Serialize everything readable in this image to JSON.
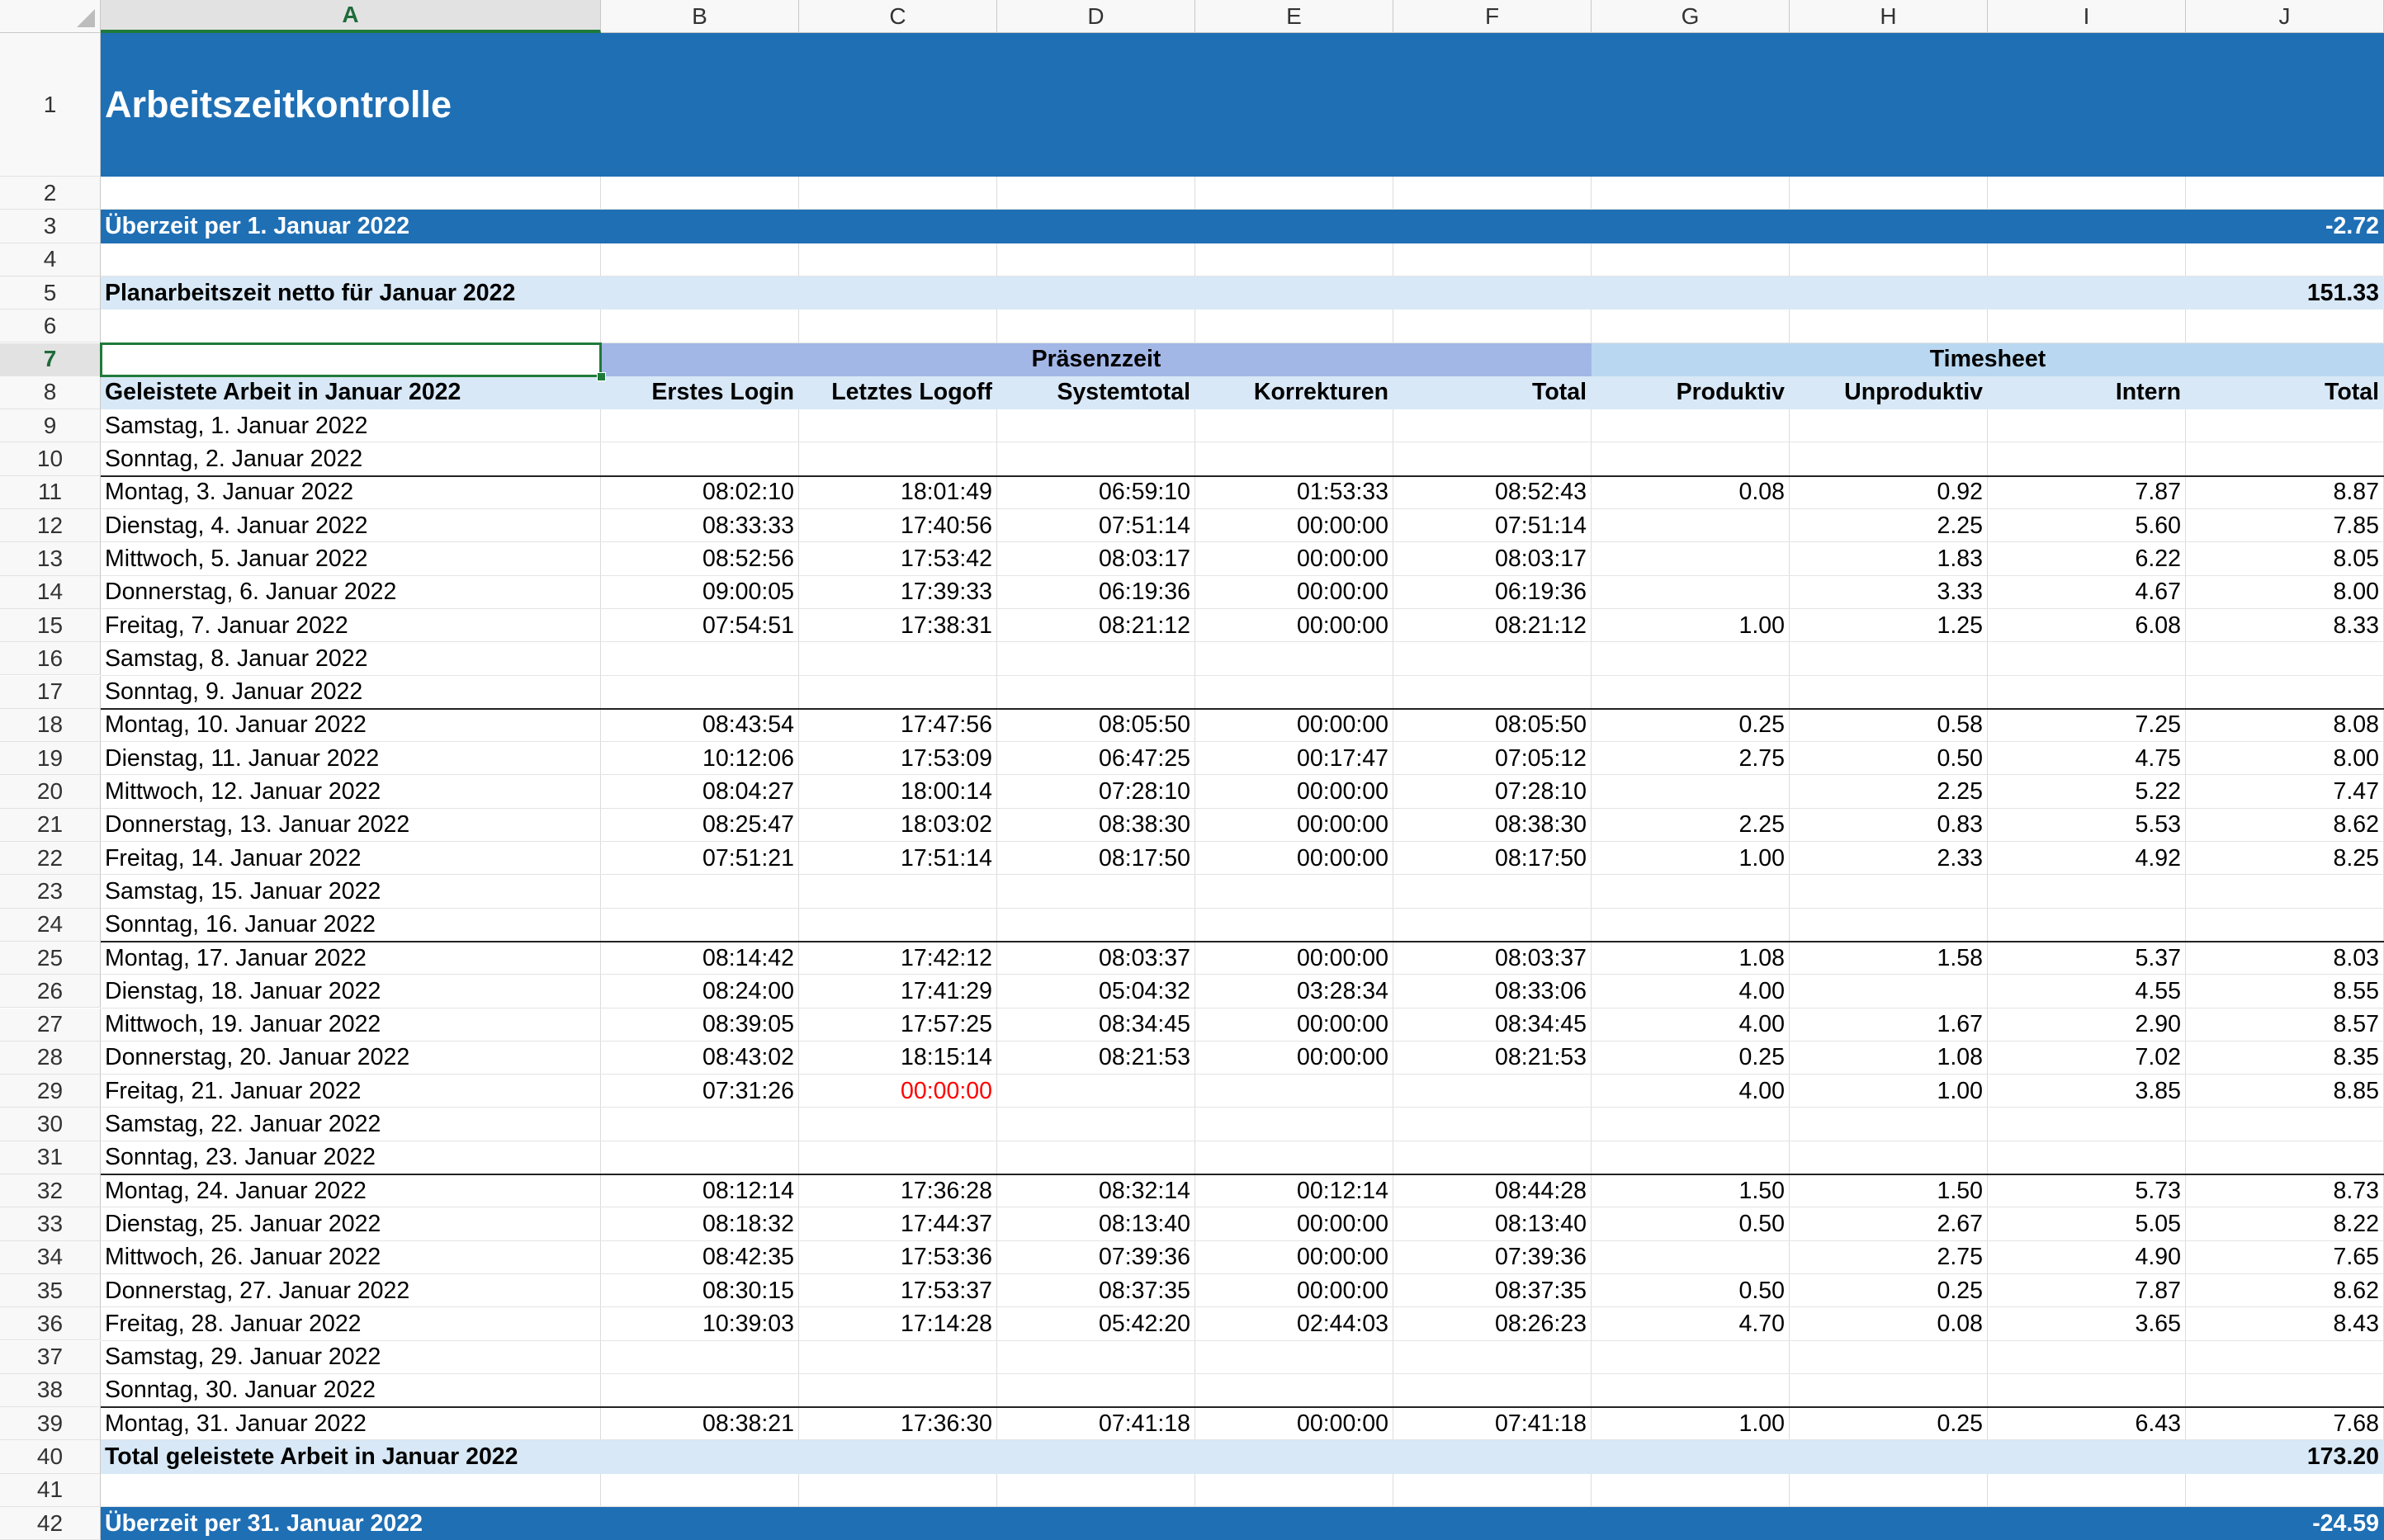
{
  "colors": {
    "dark_blue": "#1f6fb4",
    "light_blue": "#d8e8f6",
    "praesenz_blue": "#a3b7e6",
    "timesheet_blue": "#b9d7f0",
    "header_gray": "#f8f8f8",
    "selection_green": "#1f7a3a",
    "error_red": "#ff0000"
  },
  "columns": [
    "A",
    "B",
    "C",
    "D",
    "E",
    "F",
    "G",
    "H",
    "I",
    "J"
  ],
  "row_numbers": [
    "1",
    "2",
    "3",
    "4",
    "5",
    "6",
    "7",
    "8",
    "9",
    "10",
    "11",
    "12",
    "13",
    "14",
    "15",
    "16",
    "17",
    "18",
    "19",
    "20",
    "21",
    "22",
    "23",
    "24",
    "25",
    "26",
    "27",
    "28",
    "29",
    "30",
    "31",
    "32",
    "33",
    "34",
    "35",
    "36",
    "37",
    "38",
    "39",
    "40",
    "41",
    "42"
  ],
  "selected_cell": "A7",
  "title": "Arbeitszeitkontrolle",
  "overtime_start": {
    "label": "Überzeit per 1. Januar 2022",
    "value": "-2.72"
  },
  "planned": {
    "label": "Planarbeitszeit netto für Januar 2022",
    "value": "151.33"
  },
  "group_headers": {
    "praesenz": "Präsenzzeit",
    "timesheet": "Timesheet"
  },
  "headers": [
    "Geleistete Arbeit in Januar 2022",
    "Erstes Login",
    "Letztes Logoff",
    "Systemtotal",
    "Korrekturen",
    "Total",
    "Produktiv",
    "Unproduktiv",
    "Intern",
    "Total"
  ],
  "days": [
    {
      "date": "Samstag, 1. Januar 2022",
      "login": "",
      "logoff": "",
      "systotal": "",
      "korr": "",
      "total": "",
      "prod": "",
      "unprod": "",
      "intern": "",
      "ts_total": ""
    },
    {
      "date": "Sonntag, 2. Januar 2022",
      "login": "",
      "logoff": "",
      "systotal": "",
      "korr": "",
      "total": "",
      "prod": "",
      "unprod": "",
      "intern": "",
      "ts_total": ""
    },
    {
      "date": "Montag, 3. Januar 2022",
      "login": "08:02:10",
      "logoff": "18:01:49",
      "systotal": "06:59:10",
      "korr": "01:53:33",
      "total": "08:52:43",
      "prod": "0.08",
      "unprod": "0.92",
      "intern": "7.87",
      "ts_total": "8.87"
    },
    {
      "date": "Dienstag, 4. Januar 2022",
      "login": "08:33:33",
      "logoff": "17:40:56",
      "systotal": "07:51:14",
      "korr": "00:00:00",
      "total": "07:51:14",
      "prod": "",
      "unprod": "2.25",
      "intern": "5.60",
      "ts_total": "7.85"
    },
    {
      "date": "Mittwoch, 5. Januar 2022",
      "login": "08:52:56",
      "logoff": "17:53:42",
      "systotal": "08:03:17",
      "korr": "00:00:00",
      "total": "08:03:17",
      "prod": "",
      "unprod": "1.83",
      "intern": "6.22",
      "ts_total": "8.05"
    },
    {
      "date": "Donnerstag, 6. Januar 2022",
      "login": "09:00:05",
      "logoff": "17:39:33",
      "systotal": "06:19:36",
      "korr": "00:00:00",
      "total": "06:19:36",
      "prod": "",
      "unprod": "3.33",
      "intern": "4.67",
      "ts_total": "8.00"
    },
    {
      "date": "Freitag, 7. Januar 2022",
      "login": "07:54:51",
      "logoff": "17:38:31",
      "systotal": "08:21:12",
      "korr": "00:00:00",
      "total": "08:21:12",
      "prod": "1.00",
      "unprod": "1.25",
      "intern": "6.08",
      "ts_total": "8.33"
    },
    {
      "date": "Samstag, 8. Januar 2022",
      "login": "",
      "logoff": "",
      "systotal": "",
      "korr": "",
      "total": "",
      "prod": "",
      "unprod": "",
      "intern": "",
      "ts_total": ""
    },
    {
      "date": "Sonntag, 9. Januar 2022",
      "login": "",
      "logoff": "",
      "systotal": "",
      "korr": "",
      "total": "",
      "prod": "",
      "unprod": "",
      "intern": "",
      "ts_total": ""
    },
    {
      "date": "Montag, 10. Januar 2022",
      "login": "08:43:54",
      "logoff": "17:47:56",
      "systotal": "08:05:50",
      "korr": "00:00:00",
      "total": "08:05:50",
      "prod": "0.25",
      "unprod": "0.58",
      "intern": "7.25",
      "ts_total": "8.08"
    },
    {
      "date": "Dienstag, 11. Januar 2022",
      "login": "10:12:06",
      "logoff": "17:53:09",
      "systotal": "06:47:25",
      "korr": "00:17:47",
      "total": "07:05:12",
      "prod": "2.75",
      "unprod": "0.50",
      "intern": "4.75",
      "ts_total": "8.00"
    },
    {
      "date": "Mittwoch, 12. Januar 2022",
      "login": "08:04:27",
      "logoff": "18:00:14",
      "systotal": "07:28:10",
      "korr": "00:00:00",
      "total": "07:28:10",
      "prod": "",
      "unprod": "2.25",
      "intern": "5.22",
      "ts_total": "7.47"
    },
    {
      "date": "Donnerstag, 13. Januar 2022",
      "login": "08:25:47",
      "logoff": "18:03:02",
      "systotal": "08:38:30",
      "korr": "00:00:00",
      "total": "08:38:30",
      "prod": "2.25",
      "unprod": "0.83",
      "intern": "5.53",
      "ts_total": "8.62"
    },
    {
      "date": "Freitag, 14. Januar 2022",
      "login": "07:51:21",
      "logoff": "17:51:14",
      "systotal": "08:17:50",
      "korr": "00:00:00",
      "total": "08:17:50",
      "prod": "1.00",
      "unprod": "2.33",
      "intern": "4.92",
      "ts_total": "8.25"
    },
    {
      "date": "Samstag, 15. Januar 2022",
      "login": "",
      "logoff": "",
      "systotal": "",
      "korr": "",
      "total": "",
      "prod": "",
      "unprod": "",
      "intern": "",
      "ts_total": ""
    },
    {
      "date": "Sonntag, 16. Januar 2022",
      "login": "",
      "logoff": "",
      "systotal": "",
      "korr": "",
      "total": "",
      "prod": "",
      "unprod": "",
      "intern": "",
      "ts_total": ""
    },
    {
      "date": "Montag, 17. Januar 2022",
      "login": "08:14:42",
      "logoff": "17:42:12",
      "systotal": "08:03:37",
      "korr": "00:00:00",
      "total": "08:03:37",
      "prod": "1.08",
      "unprod": "1.58",
      "intern": "5.37",
      "ts_total": "8.03"
    },
    {
      "date": "Dienstag, 18. Januar 2022",
      "login": "08:24:00",
      "logoff": "17:41:29",
      "systotal": "05:04:32",
      "korr": "03:28:34",
      "total": "08:33:06",
      "prod": "4.00",
      "unprod": "",
      "intern": "4.55",
      "ts_total": "8.55"
    },
    {
      "date": "Mittwoch, 19. Januar 2022",
      "login": "08:39:05",
      "logoff": "17:57:25",
      "systotal": "08:34:45",
      "korr": "00:00:00",
      "total": "08:34:45",
      "prod": "4.00",
      "unprod": "1.67",
      "intern": "2.90",
      "ts_total": "8.57"
    },
    {
      "date": "Donnerstag, 20. Januar 2022",
      "login": "08:43:02",
      "logoff": "18:15:14",
      "systotal": "08:21:53",
      "korr": "00:00:00",
      "total": "08:21:53",
      "prod": "0.25",
      "unprod": "1.08",
      "intern": "7.02",
      "ts_total": "8.35"
    },
    {
      "date": "Freitag, 21. Januar 2022",
      "login": "07:31:26",
      "logoff": "00:00:00",
      "systotal": "",
      "korr": "",
      "total": "",
      "prod": "4.00",
      "unprod": "1.00",
      "intern": "3.85",
      "ts_total": "8.85",
      "logoff_error": true
    },
    {
      "date": "Samstag, 22. Januar 2022",
      "login": "",
      "logoff": "",
      "systotal": "",
      "korr": "",
      "total": "",
      "prod": "",
      "unprod": "",
      "intern": "",
      "ts_total": ""
    },
    {
      "date": "Sonntag, 23. Januar 2022",
      "login": "",
      "logoff": "",
      "systotal": "",
      "korr": "",
      "total": "",
      "prod": "",
      "unprod": "",
      "intern": "",
      "ts_total": ""
    },
    {
      "date": "Montag, 24. Januar 2022",
      "login": "08:12:14",
      "logoff": "17:36:28",
      "systotal": "08:32:14",
      "korr": "00:12:14",
      "total": "08:44:28",
      "prod": "1.50",
      "unprod": "1.50",
      "intern": "5.73",
      "ts_total": "8.73"
    },
    {
      "date": "Dienstag, 25. Januar 2022",
      "login": "08:18:32",
      "logoff": "17:44:37",
      "systotal": "08:13:40",
      "korr": "00:00:00",
      "total": "08:13:40",
      "prod": "0.50",
      "unprod": "2.67",
      "intern": "5.05",
      "ts_total": "8.22"
    },
    {
      "date": "Mittwoch, 26. Januar 2022",
      "login": "08:42:35",
      "logoff": "17:53:36",
      "systotal": "07:39:36",
      "korr": "00:00:00",
      "total": "07:39:36",
      "prod": "",
      "unprod": "2.75",
      "intern": "4.90",
      "ts_total": "7.65"
    },
    {
      "date": "Donnerstag, 27. Januar 2022",
      "login": "08:30:15",
      "logoff": "17:53:37",
      "systotal": "08:37:35",
      "korr": "00:00:00",
      "total": "08:37:35",
      "prod": "0.50",
      "unprod": "0.25",
      "intern": "7.87",
      "ts_total": "8.62"
    },
    {
      "date": "Freitag, 28. Januar 2022",
      "login": "10:39:03",
      "logoff": "17:14:28",
      "systotal": "05:42:20",
      "korr": "02:44:03",
      "total": "08:26:23",
      "prod": "4.70",
      "unprod": "0.08",
      "intern": "3.65",
      "ts_total": "8.43"
    },
    {
      "date": "Samstag, 29. Januar 2022",
      "login": "",
      "logoff": "",
      "systotal": "",
      "korr": "",
      "total": "",
      "prod": "",
      "unprod": "",
      "intern": "",
      "ts_total": ""
    },
    {
      "date": "Sonntag, 30. Januar 2022",
      "login": "",
      "logoff": "",
      "systotal": "",
      "korr": "",
      "total": "",
      "prod": "",
      "unprod": "",
      "intern": "",
      "ts_total": ""
    },
    {
      "date": "Montag, 31. Januar 2022",
      "login": "08:38:21",
      "logoff": "17:36:30",
      "systotal": "07:41:18",
      "korr": "00:00:00",
      "total": "07:41:18",
      "prod": "1.00",
      "unprod": "0.25",
      "intern": "6.43",
      "ts_total": "7.68"
    }
  ],
  "total_row": {
    "label": "Total geleistete Arbeit in Januar 2022",
    "value": "173.20"
  },
  "overtime_end": {
    "label": "Überzeit per 31. Januar 2022",
    "value": "-24.59"
  }
}
